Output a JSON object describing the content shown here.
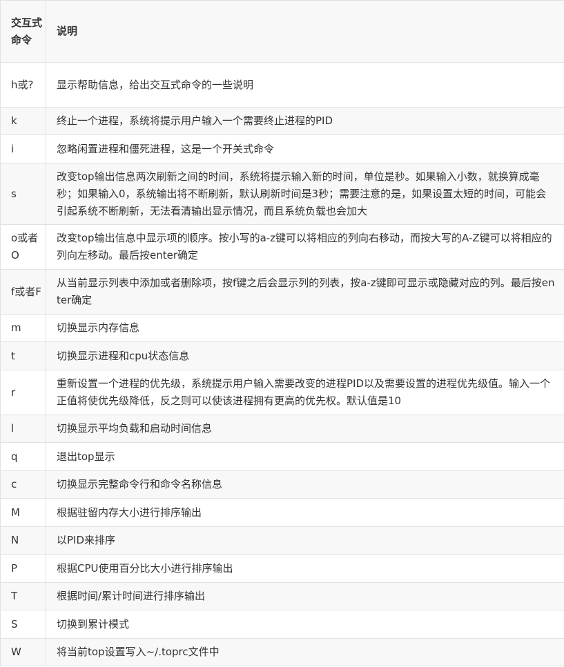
{
  "table": {
    "headers": [
      "交互式命令",
      "说明"
    ],
    "rows": [
      {
        "cmd": "h或?",
        "desc": "显示帮助信息，给出交互式命令的一些说明"
      },
      {
        "cmd": "k",
        "desc": "终止一个进程，系统将提示用户输入一个需要终止进程的PID"
      },
      {
        "cmd": "i",
        "desc": "忽略闲置进程和僵死进程，这是一个开关式命令"
      },
      {
        "cmd": "s",
        "desc": "改变top输出信息两次刷新之间的时间，系统将提示输入新的时间，单位是秒。如果输入小数，就换算成毫秒；如果输入0，系统输出将不断刷新，默认刷新时间是3秒；需要注意的是，如果设置太短的时间，可能会引起系统不断刷新，无法看清输出显示情况，而且系统负载也会加大"
      },
      {
        "cmd": "o或者O",
        "desc": "改变top输出信息中显示项的顺序。按小写的a-z键可以将相应的列向右移动，而按大写的A-Z键可以将相应的列向左移动。最后按enter确定"
      },
      {
        "cmd": "f或者F",
        "desc": "从当前显示列表中添加或者删除项，按f键之后会显示列的列表，按a-z键即可显示或隐藏对应的列。最后按enter确定"
      },
      {
        "cmd": "m",
        "desc": "切换显示内存信息"
      },
      {
        "cmd": "t",
        "desc": "切换显示进程和cpu状态信息"
      },
      {
        "cmd": "r",
        "desc": "重新设置一个进程的优先级，系统提示用户输入需要改变的进程PID以及需要设置的进程优先级值。输入一个正值将使优先级降低，反之则可以使该进程拥有更高的优先权。默认值是10"
      },
      {
        "cmd": "l",
        "desc": "切换显示平均负载和启动时间信息"
      },
      {
        "cmd": "q",
        "desc": "退出top显示"
      },
      {
        "cmd": "c",
        "desc": "切换显示完整命令行和命令名称信息"
      },
      {
        "cmd": "M",
        "desc": "根据驻留内存大小进行排序输出"
      },
      {
        "cmd": "N",
        "desc": "以PID来排序"
      },
      {
        "cmd": "P",
        "desc": "根据CPU使用百分比大小进行排序输出"
      },
      {
        "cmd": "T",
        "desc": "根据时间/累计时间进行排序输出"
      },
      {
        "cmd": "S",
        "desc": "切换到累计模式"
      },
      {
        "cmd": "W",
        "desc": "将当前top设置写入~/.toprc文件中"
      }
    ]
  }
}
